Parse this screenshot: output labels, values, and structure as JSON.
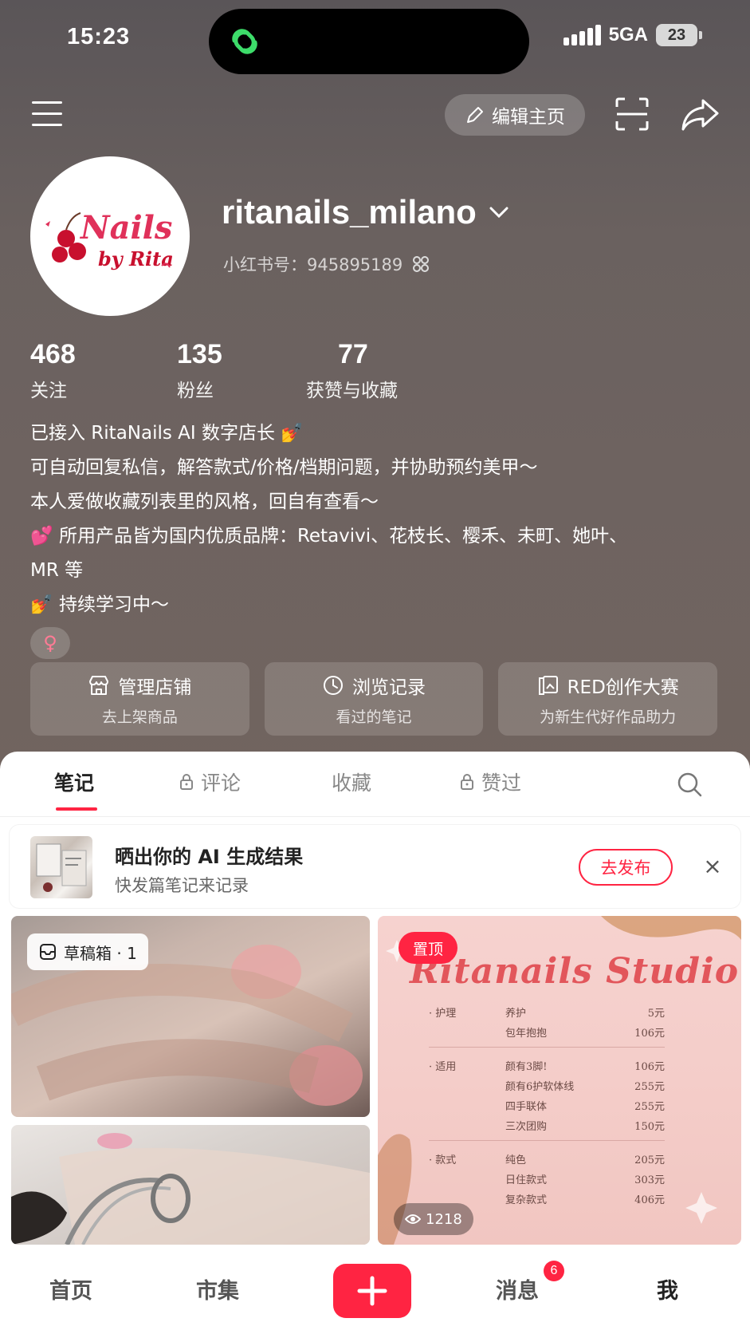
{
  "status_bar": {
    "time": "15:23",
    "network": "5GA",
    "battery": "23"
  },
  "top_nav": {
    "edit_label": "编辑主页"
  },
  "profile": {
    "username": "ritanails_milano",
    "id_label": "小红书号：",
    "id_value": "945895189",
    "avatar_text": "Nails by Rita"
  },
  "stats": [
    {
      "value": "468",
      "label": "关注"
    },
    {
      "value": "135",
      "label": "粉丝"
    },
    {
      "value": "77",
      "label": "获赞与收藏"
    }
  ],
  "bio": [
    "已接入 RitaNails AI 数字店长 💅",
    "可自动回复私信，解答款式/价格/档期问题，并协助预约美甲～",
    "本人爱做收藏列表里的风格，回自有查看～",
    "💕 所用产品皆为国内优质品牌：Retavivi、花枝长、樱禾、未町、她叶、",
    "MR 等",
    "💅 持续学习中～"
  ],
  "gender_symbol": "♀",
  "cards": [
    {
      "title": "管理店铺",
      "sub": "去上架商品",
      "icon": "shop-icon"
    },
    {
      "title": "浏览记录",
      "sub": "看过的笔记",
      "icon": "clock-icon"
    },
    {
      "title": "RED创作大赛",
      "sub": "为新生代好作品助力",
      "icon": "gallery-icon"
    }
  ],
  "tabs": [
    {
      "label": "笔记",
      "locked": false,
      "active": true
    },
    {
      "label": "评论",
      "locked": true,
      "active": false
    },
    {
      "label": "收藏",
      "locked": false,
      "active": false
    },
    {
      "label": "赞过",
      "locked": true,
      "active": false
    }
  ],
  "ai_banner": {
    "title": "晒出你的 AI 生成结果",
    "subtitle": "快发篇笔记来记录",
    "button": "去发布"
  },
  "notes": {
    "draft_label": "草稿箱 · 1",
    "pinned_label": "置顶",
    "views": "1218",
    "studio_title": "Ritanails Studio",
    "menu": [
      {
        "cat": "· 护理",
        "item": "养护",
        "price": "5元"
      },
      {
        "cat": "",
        "item": "包年抱抱",
        "price": "106元"
      },
      {
        "cat": "· 适用",
        "item": "颜有3脚!",
        "price": "106元"
      },
      {
        "cat": "",
        "item": "颜有6护软体线",
        "price": "255元"
      },
      {
        "cat": "",
        "item": "四手联体",
        "price": "255元"
      },
      {
        "cat": "",
        "item": "三次团购",
        "price": "150元"
      },
      {
        "cat": "· 款式",
        "item": "纯色",
        "price": "205元"
      },
      {
        "cat": "",
        "item": "日住款式",
        "price": "303元"
      },
      {
        "cat": "",
        "item": "复杂款式",
        "price": "406元"
      }
    ]
  },
  "bottom_nav": {
    "home": "首页",
    "market": "市集",
    "messages": "消息",
    "messages_badge": "6",
    "me": "我"
  },
  "colors": {
    "accent": "#ff2442",
    "header_bg": "#6a615f"
  }
}
